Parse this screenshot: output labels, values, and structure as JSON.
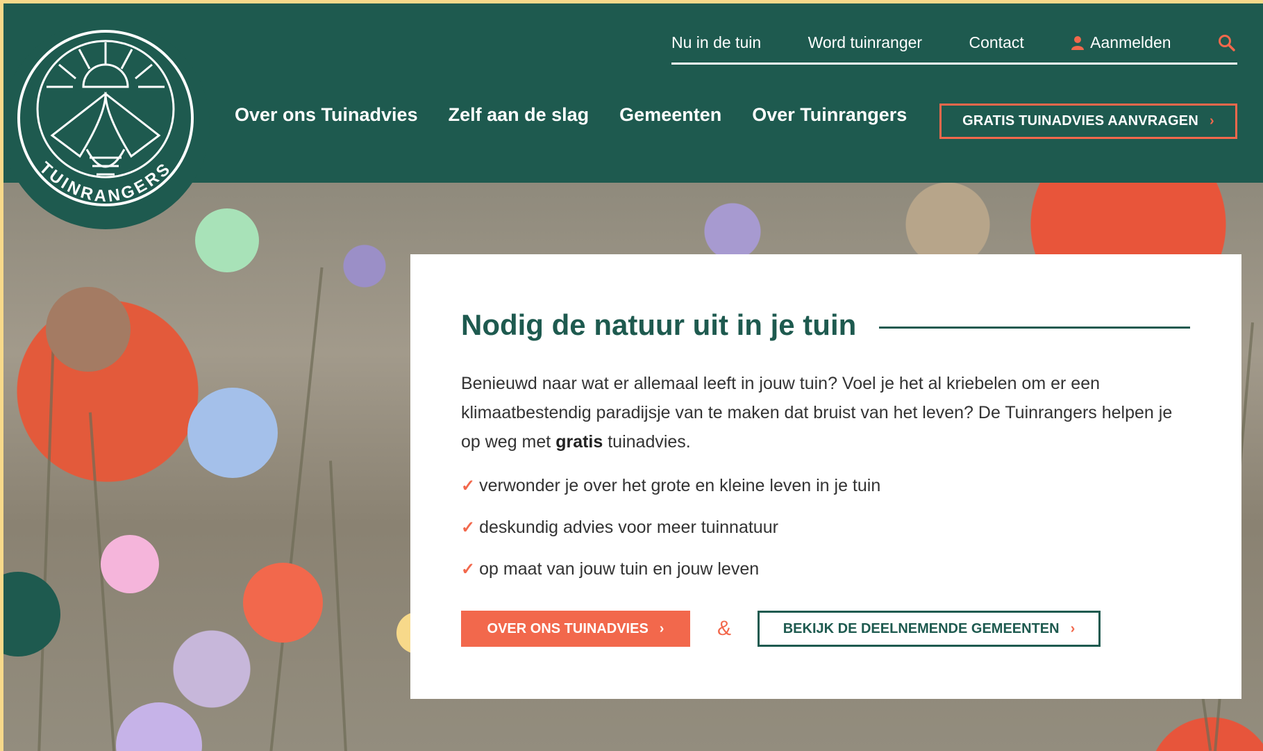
{
  "brand": {
    "name": "TUINRANGERS"
  },
  "colors": {
    "primary_green": "#1e5a4f",
    "accent_orange": "#f2684c",
    "page_frame": "#f7d98a"
  },
  "top_nav": {
    "items": [
      "Nu in de tuin",
      "Word tuinranger",
      "Contact"
    ],
    "login": "Aanmelden",
    "login_icon": "user-icon",
    "search_icon": "search-icon"
  },
  "main_nav": {
    "items": [
      "Over ons Tuinadvies",
      "Zelf aan de slag",
      "Gemeenten",
      "Over Tuinrangers"
    ],
    "cta": "GRATIS TUINADVIES AANVRAGEN"
  },
  "hero": {
    "title": "Nodig de natuur uit in je tuin",
    "intro_before": "Benieuwd naar wat er allemaal leeft in jouw tuin? Voel je het al kriebelen om er een klimaatbestendig paradijsje van te maken dat bruist van het leven? De Tuinrangers helpen je op weg met ",
    "intro_bold": "gratis",
    "intro_after": " tuinadvies.",
    "checks": [
      "verwonder je over het grote en kleine leven in je tuin",
      "deskundig advies voor meer tuinnatuur",
      "op maat van jouw tuin en jouw leven"
    ],
    "button_primary": "OVER ONS TUINADVIES",
    "ampersand": "&",
    "button_secondary": "BEKIJK DE DEELNEMENDE GEMEENTEN"
  },
  "decor_dots": [
    "#a8e2b8",
    "#a47b63",
    "#a4c0ea",
    "#f5b5db",
    "#f2684c",
    "#1e5a4f",
    "#c6b3e8",
    "#f7d98a"
  ]
}
